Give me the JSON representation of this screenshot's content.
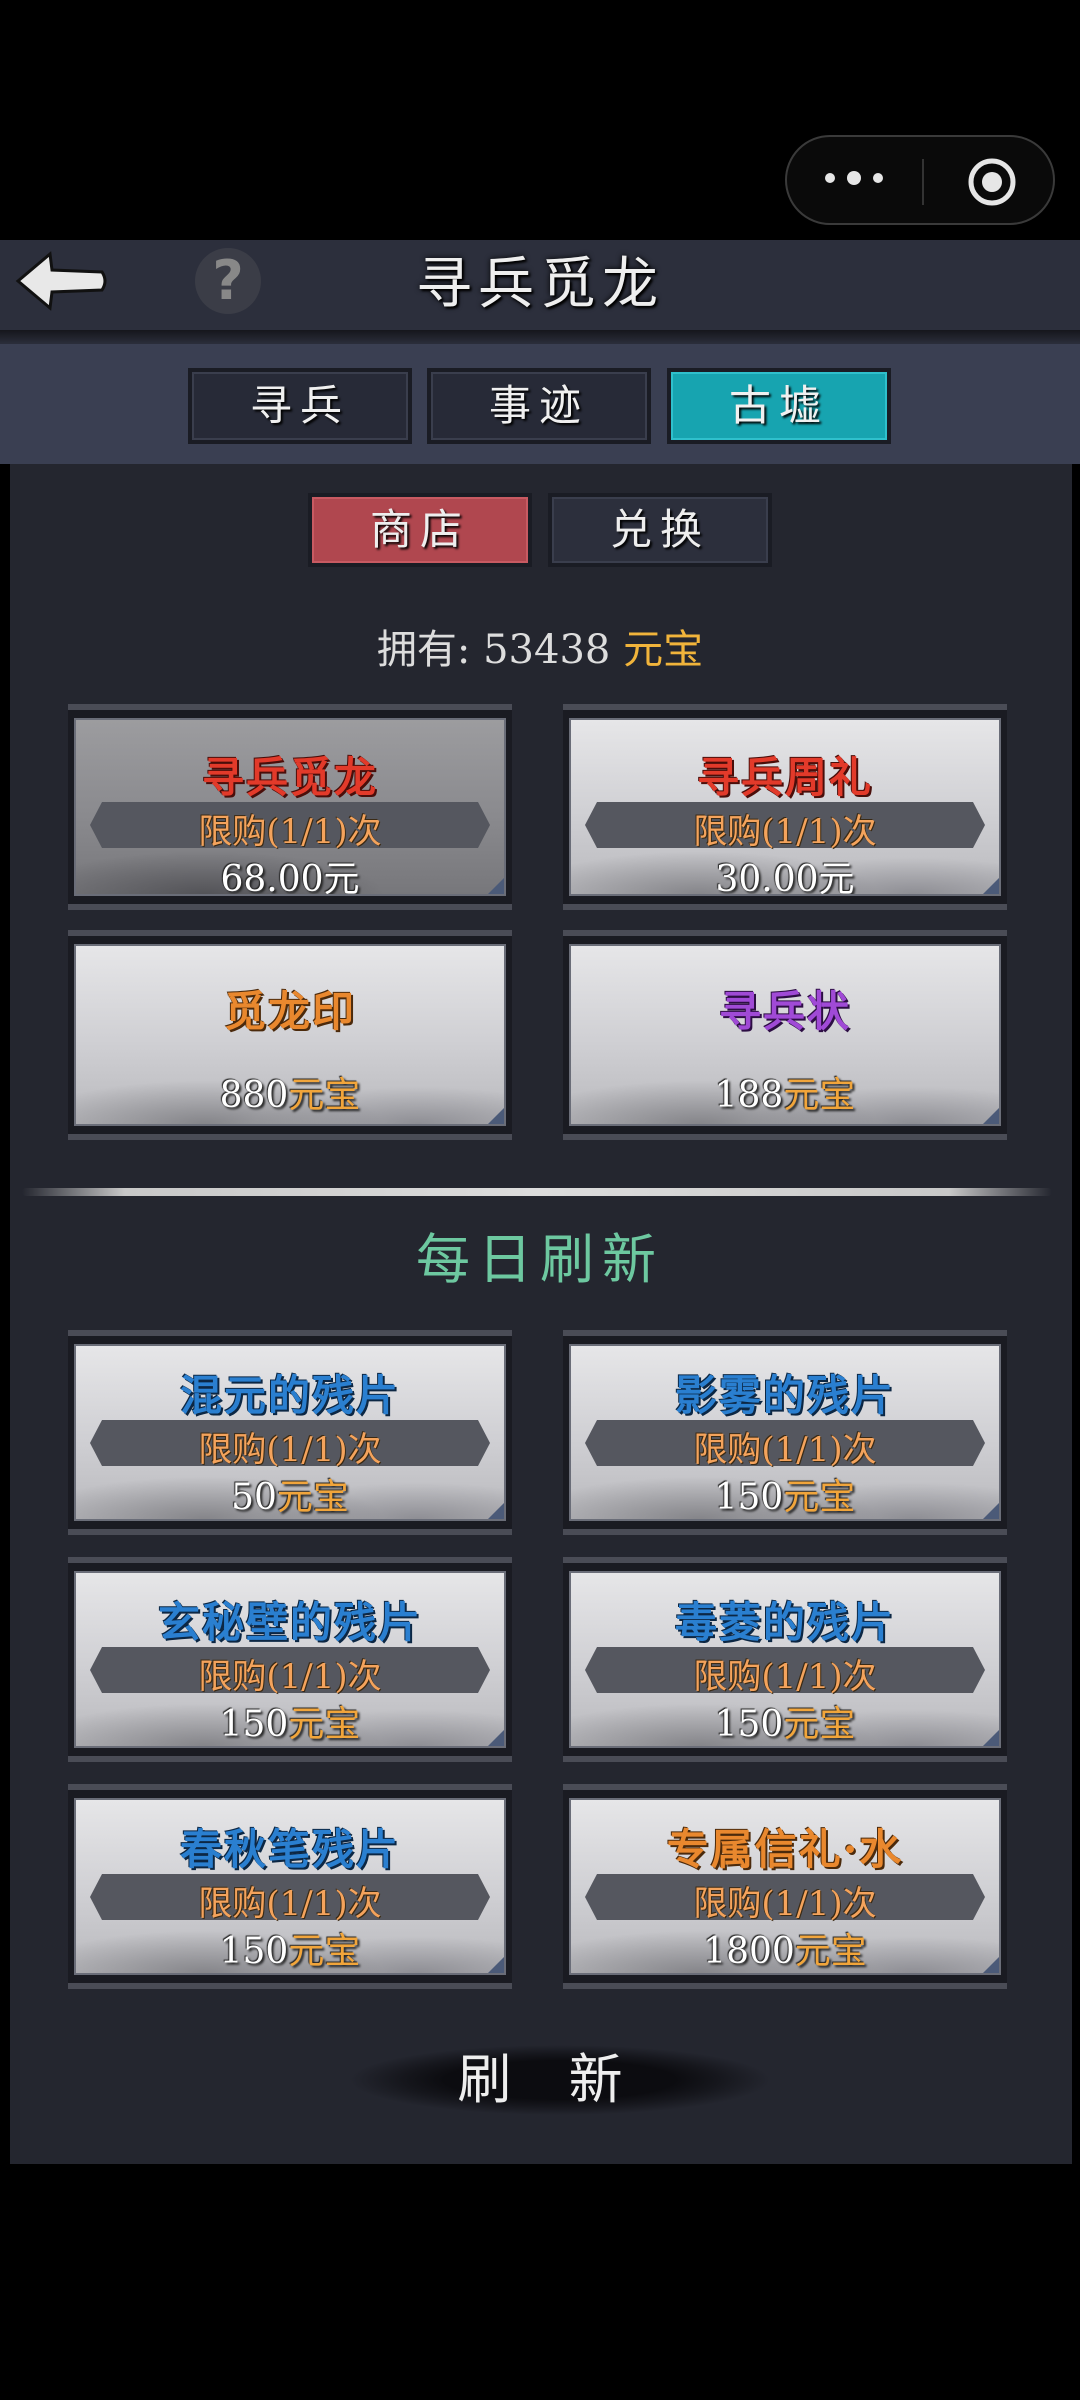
{
  "header": {
    "title": "寻兵觅龙"
  },
  "tabs": [
    {
      "label": "寻兵",
      "active": false
    },
    {
      "label": "事迹",
      "active": false
    },
    {
      "label": "古墟",
      "active": true
    }
  ],
  "subtabs": [
    {
      "label": "商店",
      "active": true
    },
    {
      "label": "兑换",
      "active": false
    }
  ],
  "owned": {
    "label": "拥有:",
    "amount": "53438",
    "currency": "元宝"
  },
  "shop": [
    {
      "name": "寻兵觅龙",
      "limit": "限购(1/1)次",
      "price": "68.00元",
      "currency": ""
    },
    {
      "name": "寻兵周礼",
      "limit": "限购(1/1)次",
      "price": "30.00元",
      "currency": ""
    },
    {
      "name": "觅龙印",
      "limit": "",
      "price": "880",
      "currency": "元宝"
    },
    {
      "name": "寻兵状",
      "limit": "",
      "price": "188",
      "currency": "元宝"
    }
  ],
  "daily": {
    "title": "每日刷新",
    "items": [
      {
        "name": "混元的残片",
        "limit": "限购(1/1)次",
        "price": "50",
        "currency": "元宝"
      },
      {
        "name": "影雾的残片",
        "limit": "限购(1/1)次",
        "price": "150",
        "currency": "元宝"
      },
      {
        "name": "玄秘壁的残片",
        "limit": "限购(1/1)次",
        "price": "150",
        "currency": "元宝"
      },
      {
        "name": "毒菱的残片",
        "limit": "限购(1/1)次",
        "price": "150",
        "currency": "元宝"
      },
      {
        "name": "春秋笔残片",
        "limit": "限购(1/1)次",
        "price": "150",
        "currency": "元宝"
      },
      {
        "name": "专属信礼·水",
        "limit": "限购(1/1)次",
        "price": "1800",
        "currency": "元宝"
      }
    ]
  },
  "refresh_label": "刷 新",
  "help_label": "?",
  "colors": {
    "accent_tab": "#17a4b0",
    "shop_tab": "#b0474f",
    "currency": "#f1a53b",
    "daily_title": "#6dc8a0"
  },
  "icons": [
    "back-arrow-icon",
    "help-icon",
    "more-dots-icon",
    "close-target-icon"
  ]
}
